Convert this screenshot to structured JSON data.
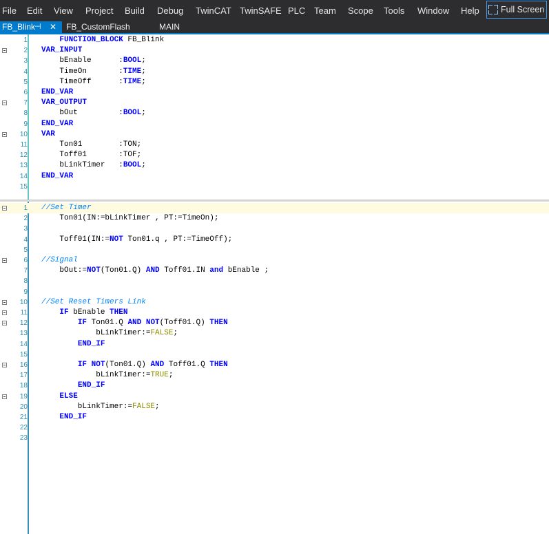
{
  "menubar": {
    "items": [
      "File",
      "Edit",
      "View",
      "Project",
      "Build",
      "Debug",
      "TwinCAT",
      "TwinSAFE",
      "PLC",
      "Team",
      "Scope",
      "Tools",
      "Window",
      "Help"
    ],
    "fullscreen_label": "Full Screen"
  },
  "tabs": {
    "active_label": "FB_Blink",
    "pin_glyph": "⊣",
    "close_glyph": "✕",
    "tab2_label": "FB_CustomFlash",
    "tab3_label": "MAIN"
  },
  "colors": {
    "accent": "#007acc",
    "keyword": "#0000ff",
    "comment": "#0080ff",
    "literal": "#8b8b00",
    "line_number": "#2b91af"
  },
  "declaration": {
    "lines": [
      {
        "n": "1",
        "fold": false,
        "segs": [
          {
            "t": "    "
          },
          {
            "t": "FUNCTION_BLOCK",
            "c": "kw"
          },
          {
            "t": " FB_Blink"
          }
        ]
      },
      {
        "n": "2",
        "fold": true,
        "segs": [
          {
            "t": "VAR_INPUT",
            "c": "kw"
          }
        ]
      },
      {
        "n": "3",
        "fold": false,
        "segs": [
          {
            "t": "    bEnable      :"
          },
          {
            "t": "BOOL",
            "c": "kw"
          },
          {
            "t": ";"
          }
        ]
      },
      {
        "n": "4",
        "fold": false,
        "segs": [
          {
            "t": "    TimeOn       :"
          },
          {
            "t": "TIME",
            "c": "kw"
          },
          {
            "t": ";"
          }
        ]
      },
      {
        "n": "5",
        "fold": false,
        "segs": [
          {
            "t": "    TimeOff      :"
          },
          {
            "t": "TIME",
            "c": "kw"
          },
          {
            "t": ";"
          }
        ]
      },
      {
        "n": "6",
        "fold": false,
        "segs": [
          {
            "t": "END_VAR",
            "c": "kw"
          }
        ]
      },
      {
        "n": "7",
        "fold": true,
        "segs": [
          {
            "t": "VAR_OUTPUT",
            "c": "kw"
          }
        ]
      },
      {
        "n": "8",
        "fold": false,
        "segs": [
          {
            "t": "    bOut         :"
          },
          {
            "t": "BOOL",
            "c": "kw"
          },
          {
            "t": ";"
          }
        ]
      },
      {
        "n": "9",
        "fold": false,
        "segs": [
          {
            "t": "END_VAR",
            "c": "kw"
          }
        ]
      },
      {
        "n": "10",
        "fold": true,
        "segs": [
          {
            "t": "VAR",
            "c": "kw"
          }
        ]
      },
      {
        "n": "11",
        "fold": false,
        "segs": [
          {
            "t": "    Ton01        :TON;"
          }
        ]
      },
      {
        "n": "12",
        "fold": false,
        "segs": [
          {
            "t": "    Toff01       :TOF;"
          }
        ]
      },
      {
        "n": "13",
        "fold": false,
        "segs": [
          {
            "t": "    bLinkTimer   :"
          },
          {
            "t": "BOOL",
            "c": "kw"
          },
          {
            "t": ";"
          }
        ]
      },
      {
        "n": "14",
        "fold": false,
        "segs": [
          {
            "t": "END_VAR",
            "c": "kw"
          }
        ]
      },
      {
        "n": "15",
        "fold": false,
        "segs": []
      }
    ]
  },
  "implementation": {
    "lines": [
      {
        "n": "1",
        "fold": true,
        "current": true,
        "segs": [
          {
            "t": "//Set Timer",
            "c": "cm"
          }
        ]
      },
      {
        "n": "2",
        "fold": false,
        "segs": [
          {
            "t": "    Ton01(IN:=bLinkTimer , PT:=TimeOn);"
          }
        ]
      },
      {
        "n": "3",
        "fold": false,
        "segs": []
      },
      {
        "n": "4",
        "fold": false,
        "segs": [
          {
            "t": "    Toff01(IN:="
          },
          {
            "t": "NOT",
            "c": "kw"
          },
          {
            "t": " Ton01.q , PT:=TimeOff);"
          }
        ]
      },
      {
        "n": "5",
        "fold": false,
        "segs": []
      },
      {
        "n": "6",
        "fold": true,
        "segs": [
          {
            "t": "//Signal",
            "c": "cm"
          }
        ]
      },
      {
        "n": "7",
        "fold": false,
        "segs": [
          {
            "t": "    bOut:="
          },
          {
            "t": "NOT",
            "c": "kw"
          },
          {
            "t": "(Ton01.Q) "
          },
          {
            "t": "AND",
            "c": "kw"
          },
          {
            "t": " Toff01.IN "
          },
          {
            "t": "and",
            "c": "kw"
          },
          {
            "t": " bEnable ;"
          }
        ]
      },
      {
        "n": "8",
        "fold": false,
        "segs": []
      },
      {
        "n": "9",
        "fold": false,
        "segs": []
      },
      {
        "n": "10",
        "fold": true,
        "segs": [
          {
            "t": "//Set Reset Timers Link",
            "c": "cm"
          }
        ]
      },
      {
        "n": "11",
        "fold": true,
        "segs": [
          {
            "t": "    "
          },
          {
            "t": "IF",
            "c": "kw"
          },
          {
            "t": " bEnable "
          },
          {
            "t": "THEN",
            "c": "kw"
          }
        ]
      },
      {
        "n": "12",
        "fold": true,
        "segs": [
          {
            "t": "        "
          },
          {
            "t": "IF",
            "c": "kw"
          },
          {
            "t": " Ton01.Q "
          },
          {
            "t": "AND",
            "c": "kw"
          },
          {
            "t": " "
          },
          {
            "t": "NOT",
            "c": "kw"
          },
          {
            "t": "(Toff01.Q) "
          },
          {
            "t": "THEN",
            "c": "kw"
          }
        ]
      },
      {
        "n": "13",
        "fold": false,
        "segs": [
          {
            "t": "            bLinkTimer:="
          },
          {
            "t": "FALSE",
            "c": "lit"
          },
          {
            "t": ";"
          }
        ]
      },
      {
        "n": "14",
        "fold": false,
        "segs": [
          {
            "t": "        "
          },
          {
            "t": "END_IF",
            "c": "kw"
          }
        ]
      },
      {
        "n": "15",
        "fold": false,
        "segs": []
      },
      {
        "n": "16",
        "fold": true,
        "segs": [
          {
            "t": "        "
          },
          {
            "t": "IF",
            "c": "kw"
          },
          {
            "t": " "
          },
          {
            "t": "NOT",
            "c": "kw"
          },
          {
            "t": "(Ton01.Q) "
          },
          {
            "t": "AND",
            "c": "kw"
          },
          {
            "t": " Toff01.Q "
          },
          {
            "t": "THEN",
            "c": "kw"
          }
        ]
      },
      {
        "n": "17",
        "fold": false,
        "segs": [
          {
            "t": "            bLinkTimer:="
          },
          {
            "t": "TRUE",
            "c": "lit"
          },
          {
            "t": ";"
          }
        ]
      },
      {
        "n": "18",
        "fold": false,
        "segs": [
          {
            "t": "        "
          },
          {
            "t": "END_IF",
            "c": "kw"
          }
        ]
      },
      {
        "n": "19",
        "fold": true,
        "segs": [
          {
            "t": "    "
          },
          {
            "t": "ELSE",
            "c": "kw"
          }
        ]
      },
      {
        "n": "20",
        "fold": false,
        "segs": [
          {
            "t": "        bLinkTimer:="
          },
          {
            "t": "FALSE",
            "c": "lit"
          },
          {
            "t": ";"
          }
        ]
      },
      {
        "n": "21",
        "fold": false,
        "segs": [
          {
            "t": "    "
          },
          {
            "t": "END_IF",
            "c": "kw"
          }
        ]
      },
      {
        "n": "22",
        "fold": false,
        "segs": []
      },
      {
        "n": "23",
        "fold": false,
        "segs": []
      }
    ]
  }
}
